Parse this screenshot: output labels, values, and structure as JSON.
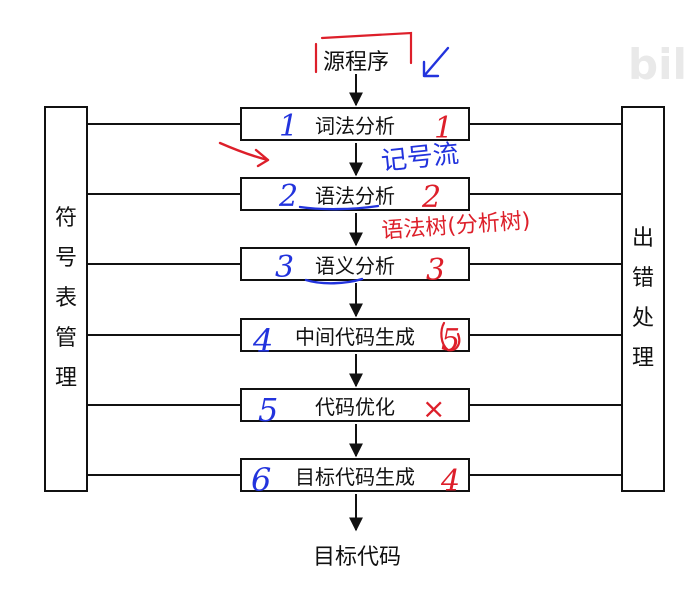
{
  "source_label": "源程序",
  "target_label": "目标代码",
  "left_box": {
    "chars": [
      "符",
      "号",
      "表",
      "管",
      "理"
    ]
  },
  "right_box": {
    "chars": [
      "出",
      "错",
      "处",
      "理"
    ]
  },
  "phases": [
    {
      "label": "词法分析"
    },
    {
      "label": "语法分析"
    },
    {
      "label": "语义分析"
    },
    {
      "label": "中间代码生成"
    },
    {
      "label": "代码优化"
    },
    {
      "label": "目标代码生成"
    }
  ],
  "watermark": "bili",
  "annotations": {
    "blue_numbers": [
      "1",
      "2",
      "3",
      "4",
      "5",
      "6"
    ],
    "red_numbers": [
      "1",
      "2",
      "3",
      "5",
      "×",
      "4"
    ],
    "blue_note": "记号流",
    "red_note": "语法树(分析树)",
    "colors": {
      "blue": "#2233dd",
      "red": "#dd1f2a",
      "ink": "#111111"
    }
  }
}
